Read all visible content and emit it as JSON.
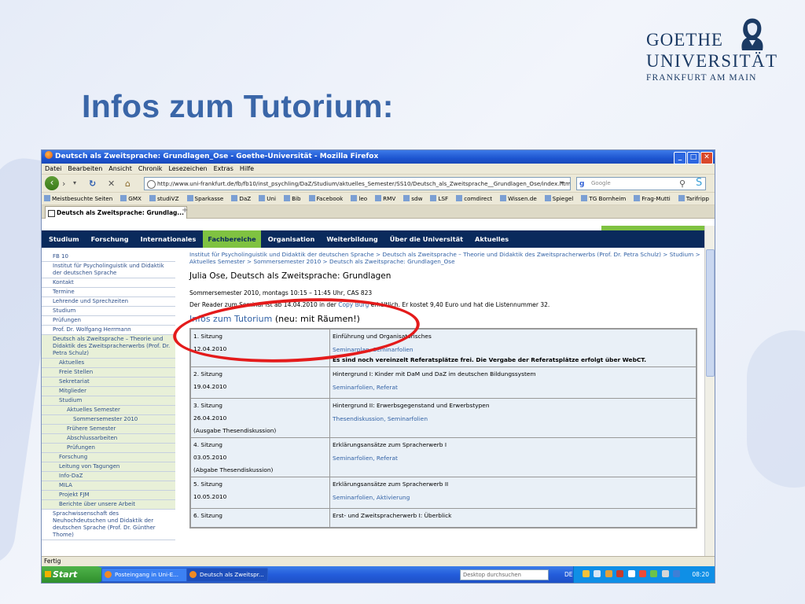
{
  "slide": {
    "title": "Infos zum Tutorium:",
    "logo": {
      "line1": "GOETHE",
      "line2": "UNIVERSITÄT",
      "line3": "FRANKFURT AM MAIN"
    }
  },
  "browser": {
    "window_title": "Deutsch als Zweitsprache: Grundlagen_Ose - Goethe-Universität - Mozilla Firefox",
    "menu": [
      "Datei",
      "Bearbeiten",
      "Ansicht",
      "Chronik",
      "Lesezeichen",
      "Extras",
      "Hilfe"
    ],
    "url": "http://www.uni-frankfurt.de/fb/fb10/inst_psychling/DaZ/Studium/aktuelles_Semester/SS10/Deutsch_als_Zweitsprache__Grundlagen_Ose/index.html",
    "search_placeholder": "Google",
    "bookmarks": [
      "Meistbesuchte Seiten",
      "GMX",
      "studiVZ",
      "Sparkasse",
      "DaZ",
      "Uni",
      "Bib",
      "Facebook",
      "leo",
      "RMV",
      "sdw",
      "LSF",
      "comdirect",
      "Wissen.de",
      "Spiegel",
      "TG Bornheim",
      "Frag-Mutti",
      "Tarifripp"
    ],
    "tab_title": "Deutsch als Zweitsprache: Grundlag...",
    "tab_plus": "+",
    "status": "Fertig"
  },
  "site": {
    "nav": [
      "Studium",
      "Forschung",
      "Internationales",
      "Fachbereiche",
      "Organisation",
      "Weiterbildung",
      "Über die Universität",
      "Aktuelles"
    ],
    "active_nav": "Fachbereiche",
    "left_nav": [
      {
        "label": "FB 10",
        "level": 1
      },
      {
        "label": "Institut für Psycholinguistik und Didaktik der deutschen Sprache",
        "level": 1
      },
      {
        "label": "Kontakt",
        "level": 1
      },
      {
        "label": "Termine",
        "level": 1
      },
      {
        "label": "Lehrende und Sprechzeiten",
        "level": 1
      },
      {
        "label": "Studium",
        "level": 1
      },
      {
        "label": "Prüfungen",
        "level": 1
      },
      {
        "label": "Prof. Dr. Wolfgang Herrmann",
        "level": 1
      },
      {
        "label": "Deutsch als Zweitsprache – Theorie und Didaktik des Zweitspracherwerbs (Prof. Dr. Petra Schulz)",
        "level": 1,
        "green": true
      },
      {
        "label": "Aktuelles",
        "level": 2,
        "green": true
      },
      {
        "label": "Freie Stellen",
        "level": 2,
        "green": true
      },
      {
        "label": "Sekretariat",
        "level": 2,
        "green": true
      },
      {
        "label": "Mitglieder",
        "level": 2,
        "green": true
      },
      {
        "label": "Studium",
        "level": 2,
        "green": true
      },
      {
        "label": "Aktuelles Semester",
        "level": 3,
        "green": true
      },
      {
        "label": "Sommersemester 2010",
        "level": 4,
        "green": true
      },
      {
        "label": "Frühere Semester",
        "level": 3,
        "green": true
      },
      {
        "label": "Abschlussarbeiten",
        "level": 3,
        "green": true
      },
      {
        "label": "Prüfungen",
        "level": 3,
        "green": true
      },
      {
        "label": "Forschung",
        "level": 2,
        "green": true
      },
      {
        "label": "Leitung von Tagungen",
        "level": 2,
        "green": true
      },
      {
        "label": "Info-DaZ",
        "level": 2,
        "green": true
      },
      {
        "label": "MILA",
        "level": 2,
        "green": true
      },
      {
        "label": "Projekt FJM",
        "level": 2,
        "green": true
      },
      {
        "label": "Berichte über unsere Arbeit",
        "level": 2,
        "green": true
      },
      {
        "label": "Sprachwissenschaft des Neuhochdeutschen und Didaktik der deutschen Sprache (Prof. Dr. Günther Thome)",
        "level": 1
      }
    ],
    "breadcrumb": "Institut für Psycholinguistik und Didaktik der deutschen Sprache > Deutsch als Zweitsprache – Theorie und Didaktik des Zweitspracherwerbs (Prof. Dr. Petra Schulz) > Studium > Aktuelles Semester > Sommersemester 2010 > Deutsch als Zweitsprache: Grundlagen_Ose",
    "heading": "Julia Ose, Deutsch als Zweitsprache: Grundlagen",
    "semester_line": "Sommersemester 2010, montags 10:15 – 11:45 Uhr, CAS 823",
    "reader_line_pre": "Der Reader zum Seminar ist ab 14.04.2010 in der ",
    "reader_link": "Copy Burg",
    "reader_line_post": " erhältlich. Er kostet 9,40 Euro und hat die Listennummer 32.",
    "infos_link": "Infos zum Tutorium",
    "infos_suffix": " (neu: mit Räumen!)",
    "sessions": [
      {
        "n": "1. Sitzung",
        "date": "12.04.2010",
        "note": "",
        "topic": "Einführung und Organisatorisches",
        "links": "Seminarplan, Seminarfolien",
        "extra": "Es sind noch vereinzelt Referatsplätze frei. Die Vergabe der Referatsplätze erfolgt über WebCT."
      },
      {
        "n": "2. Sitzung",
        "date": "19.04.2010",
        "note": "",
        "topic": "Hintergrund I: Kinder mit DaM und DaZ im deutschen Bildungssystem",
        "links": "Seminarfolien, Referat",
        "extra": ""
      },
      {
        "n": "3. Sitzung",
        "date": "26.04.2010",
        "note": "(Ausgabe Thesendiskussion)",
        "topic": "Hintergrund II: Erwerbsgegenstand und Erwerbstypen",
        "links": "Thesendiskussion, Seminarfolien",
        "extra": ""
      },
      {
        "n": "4. Sitzung",
        "date": "03.05.2010",
        "note": "(Abgabe Thesendiskussion)",
        "topic": "Erklärungsansätze zum Spracherwerb I",
        "links": "Seminarfolien, Referat",
        "extra": ""
      },
      {
        "n": "5. Sitzung",
        "date": "10.05.2010",
        "note": "",
        "topic": "Erklärungsansätze zum Spracherwerb II",
        "links": "Seminarfolien, Aktivierung",
        "extra": ""
      },
      {
        "n": "6. Sitzung",
        "date": "",
        "note": "",
        "topic": "Erst- und Zweitspracherwerb I: Überblick",
        "links": "",
        "extra": ""
      }
    ]
  },
  "taskbar": {
    "start": "Start",
    "tasks": [
      "Posteingang in Uni-E...",
      "Deutsch als Zweitspr..."
    ],
    "search_placeholder": "Desktop durchsuchen",
    "lang": "DE",
    "clock": "08:20"
  },
  "colors": {
    "title": "#3a66a8",
    "nav_bg": "#0a2a5c",
    "nav_active": "#7fc241",
    "highlight": "#e41b1b"
  }
}
